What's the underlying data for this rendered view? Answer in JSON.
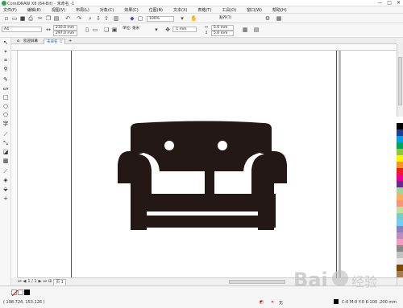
{
  "window": {
    "title": "CorelDRAW X8 (64-Bit) - 未命名 -1",
    "controls": [
      "—",
      "□",
      "✕"
    ]
  },
  "menu": [
    "文件(F)",
    "编辑(E)",
    "视图(V)",
    "布局(L)",
    "对象(C)",
    "效果(C)",
    "位图(B)",
    "文本(X)",
    "表格(T)",
    "工具(O)",
    "窗口(W)",
    "帮助(H)"
  ],
  "toolbar1": {
    "zoom": "100%",
    "snap_label": "贴齐(T)"
  },
  "toolbar2": {
    "paper_size": "A4",
    "width": "210.0 mm",
    "height": "297.0 mm",
    "units": "单位: 毫米",
    "nudge": ".1 mm",
    "dup_x": "5.0 mm",
    "dup_y": "5.0 mm"
  },
  "tabs": {
    "welcome": "欢迎屏幕",
    "document": "未命名 -1"
  },
  "page_nav": {
    "current": "1 / 1",
    "page_tab": "页 1"
  },
  "status": {
    "coords": "( 198.724, 153.126 )",
    "fill_label": "无",
    "color_info": "C:0 M:0 Y:0 K:100  .200 mm"
  },
  "palette_colors": [
    "#ffffff",
    "#000000",
    "#1c3f8f",
    "#00a0e9",
    "#00a651",
    "#8dc63f",
    "#fff200",
    "#f7941d",
    "#ed1c24",
    "#ec008c",
    "#662d91",
    "#a3d39c",
    "#fbaf5d",
    "#f69679",
    "#c4df9b",
    "#7accc8",
    "#6dcff6",
    "#8781bd",
    "#bd8cbf",
    "#f49ac1",
    "#898989",
    "#c2c2c2",
    "#e5e5e5",
    "#7d4900",
    "#a67c52"
  ],
  "accent": "#1a5fb4",
  "artwork": {
    "fill": "#231815"
  },
  "watermark": "Bai 经验"
}
